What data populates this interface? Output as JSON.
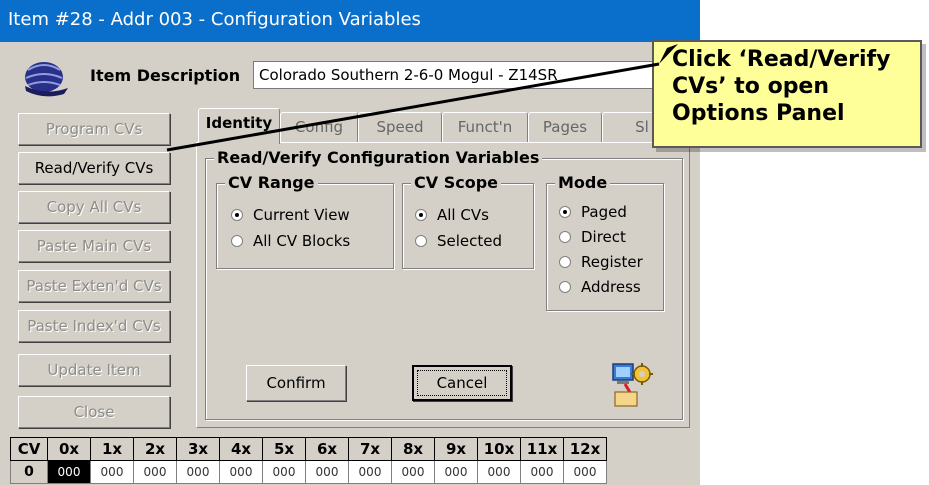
{
  "window": {
    "title": "Item #28 - Addr 003 - Configuration Variables"
  },
  "item": {
    "label": "Item Description",
    "value": "Colorado Southern 2-6-0 Mogul - Z14SR"
  },
  "sidebar": {
    "buttons": [
      {
        "label": "Program CVs",
        "enabled": false
      },
      {
        "label": "Read/Verify CVs",
        "enabled": true
      },
      {
        "label": "Copy All CVs",
        "enabled": false
      },
      {
        "label": "Paste Main CVs",
        "enabled": false
      },
      {
        "label": "Paste Exten'd CVs",
        "enabled": false
      },
      {
        "label": "Paste Index'd CVs",
        "enabled": false
      },
      {
        "label": "Update Item",
        "enabled": false
      },
      {
        "label": "Close",
        "enabled": false
      }
    ]
  },
  "tabs": [
    "Identity",
    "Config",
    "Speed",
    "Funct'n",
    "Pages",
    "Sl"
  ],
  "panel": {
    "title": "Read/Verify Configuration Variables",
    "cv_range": {
      "title": "CV Range",
      "options": [
        "Current View",
        "All CV Blocks"
      ],
      "selected": "Current View"
    },
    "cv_scope": {
      "title": "CV Scope",
      "options": [
        "All CVs",
        "Selected"
      ],
      "selected": "All CVs"
    },
    "mode": {
      "title": "Mode",
      "options": [
        "Paged",
        "Direct",
        "Register",
        "Address"
      ],
      "selected": "Paged"
    },
    "confirm_label": "Confirm",
    "cancel_label": "Cancel"
  },
  "cv_table": {
    "headers": [
      "CV",
      "0x",
      "1x",
      "2x",
      "3x",
      "4x",
      "5x",
      "6x",
      "7x",
      "8x",
      "9x",
      "10x",
      "11x",
      "12x"
    ],
    "row": [
      "0",
      "000",
      "000",
      "000",
      "000",
      "000",
      "000",
      "000",
      "000",
      "000",
      "000",
      "000",
      "000",
      "000"
    ]
  },
  "callout": {
    "lines": [
      "Click ‘Read/Verify",
      "CVs’ to open",
      "Options Panel"
    ]
  },
  "colors": {
    "titlebar": "#0a6ecb",
    "callout_bg": "#ffff99",
    "dialog_bg": "#d4d0c8"
  },
  "icons": {
    "cap": "engineer-cap-icon",
    "wizard": "computer-gear-icon"
  }
}
